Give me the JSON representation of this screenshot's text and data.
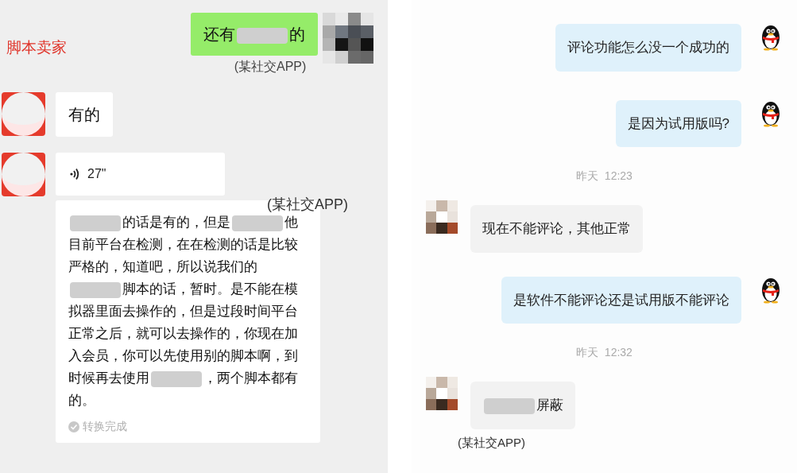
{
  "left_panel": {
    "contact_name": "脚本卖家",
    "messages": [
      {
        "outgoing": true,
        "kind": "text",
        "segments": [
          {
            "kind": "text",
            "text": "还有"
          },
          {
            "kind": "redacted"
          },
          {
            "kind": "text",
            "text": "的"
          }
        ],
        "caption": "(某社交APP)"
      },
      {
        "outgoing": false,
        "kind": "text",
        "segments": [
          {
            "kind": "text",
            "text": "有的"
          }
        ]
      },
      {
        "outgoing": false,
        "kind": "voice",
        "duration": "27\"",
        "caption": "(某社交APP)",
        "transcript": {
          "segments": [
            {
              "kind": "redacted"
            },
            {
              "kind": "text",
              "text": "的话是有的，但是"
            },
            {
              "kind": "redacted"
            },
            {
              "kind": "text",
              "text": "他目前平台在检测，在在检测的话是比较严格的，知道吧，所以说我们的"
            },
            {
              "kind": "redacted"
            },
            {
              "kind": "text",
              "text": "脚本的话，暂时。是不能在模拟器里面去操作的，但是过段时间平台正常之后，就可以去操作的，你现在加入会员，你可以先使用别的脚本啊，到时候再去使用"
            },
            {
              "kind": "redacted"
            },
            {
              "kind": "text",
              "text": "，两个脚本都有的。"
            }
          ],
          "status": "转换完成"
        }
      }
    ]
  },
  "right_panel": {
    "items": [
      {
        "kind": "message",
        "outgoing": true,
        "segments": [
          {
            "kind": "text",
            "text": "评论功能怎么没一个成功的"
          }
        ]
      },
      {
        "kind": "message",
        "outgoing": true,
        "segments": [
          {
            "kind": "text",
            "text": "是因为试用版吗?"
          }
        ]
      },
      {
        "kind": "time",
        "text": "昨天  12:23"
      },
      {
        "kind": "message",
        "outgoing": false,
        "segments": [
          {
            "kind": "text",
            "text": "现在不能评论，其他正常"
          }
        ]
      },
      {
        "kind": "message",
        "outgoing": true,
        "segments": [
          {
            "kind": "text",
            "text": "是软件不能评论还是试用版不能评论"
          }
        ]
      },
      {
        "kind": "time",
        "text": "昨天  12:32"
      },
      {
        "kind": "message",
        "outgoing": false,
        "segments": [
          {
            "kind": "redacted"
          },
          {
            "kind": "text",
            "text": "屏蔽"
          }
        ],
        "caption": "(某社交APP)"
      }
    ]
  }
}
